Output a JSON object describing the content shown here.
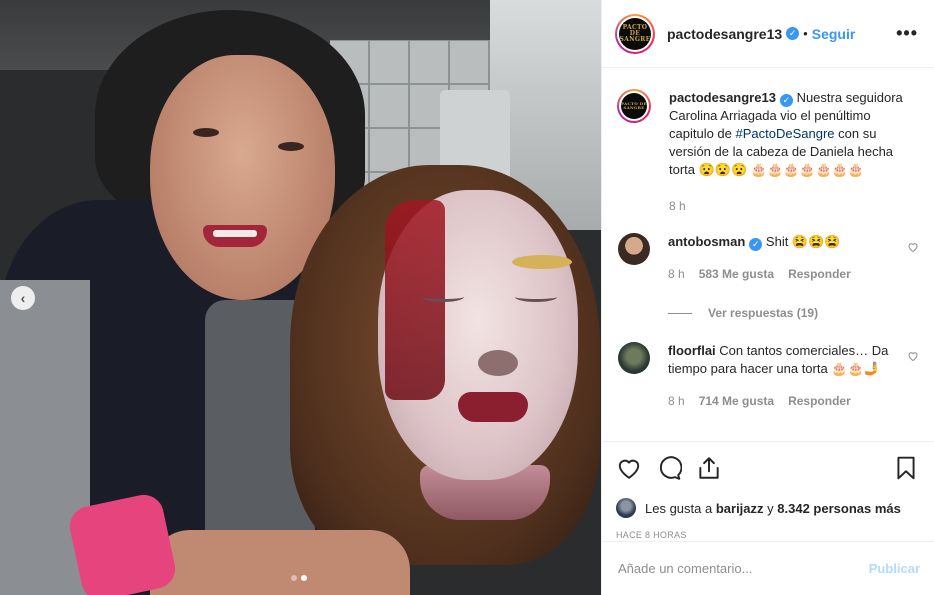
{
  "post": {
    "username": "pactodesangre13",
    "verified": true,
    "separator": "•",
    "follow_label": "Seguir",
    "more_label": "•••",
    "avatar_logo_text": "PACTO DE SANGRE",
    "carousel": {
      "prev_label": "‹",
      "slide_count": 2,
      "active_slide": 2
    }
  },
  "caption": {
    "username": "pactodesangre13",
    "text_before": "Nuestra seguidora Carolina Arriagada vio el penúltimo capitulo de",
    "hashtag": "#PactoDeSangre",
    "text_after": "con su versión de la cabeza de Daniela hecha torta 😧😧😧 🎂🎂🎂🎂🎂🎂🎂",
    "time": "8 h"
  },
  "comments": [
    {
      "username": "antobosman",
      "verified": true,
      "text": "Shit 😫😫😫",
      "time": "8 h",
      "likes": "583 Me gusta",
      "reply_label": "Responder",
      "view_replies": "Ver respuestas (19)"
    },
    {
      "username": "floorflai",
      "verified": false,
      "text": "Con tantos comerciales… Da tiempo para hacer una torta 🎂🎂🤳",
      "time": "8 h",
      "likes": "714 Me gusta",
      "reply_label": "Responder"
    }
  ],
  "likes": {
    "prefix": "Les gusta a",
    "user": "barijazz",
    "connector": "y",
    "count": "8.342 personas más"
  },
  "time_ago": "HACE 8 HORAS",
  "comment_box": {
    "placeholder": "Añade un comentario...",
    "publish_label": "Publicar"
  },
  "colors": {
    "link_blue": "#3897f0",
    "hashtag_blue": "#003569",
    "muted_gray": "#8e8e8e",
    "publish_disabled": "#b3dbff"
  },
  "icons": [
    "chevron-left-icon",
    "verified-icon",
    "more-icon",
    "heart-icon",
    "comment-icon",
    "share-icon",
    "bookmark-icon"
  ]
}
